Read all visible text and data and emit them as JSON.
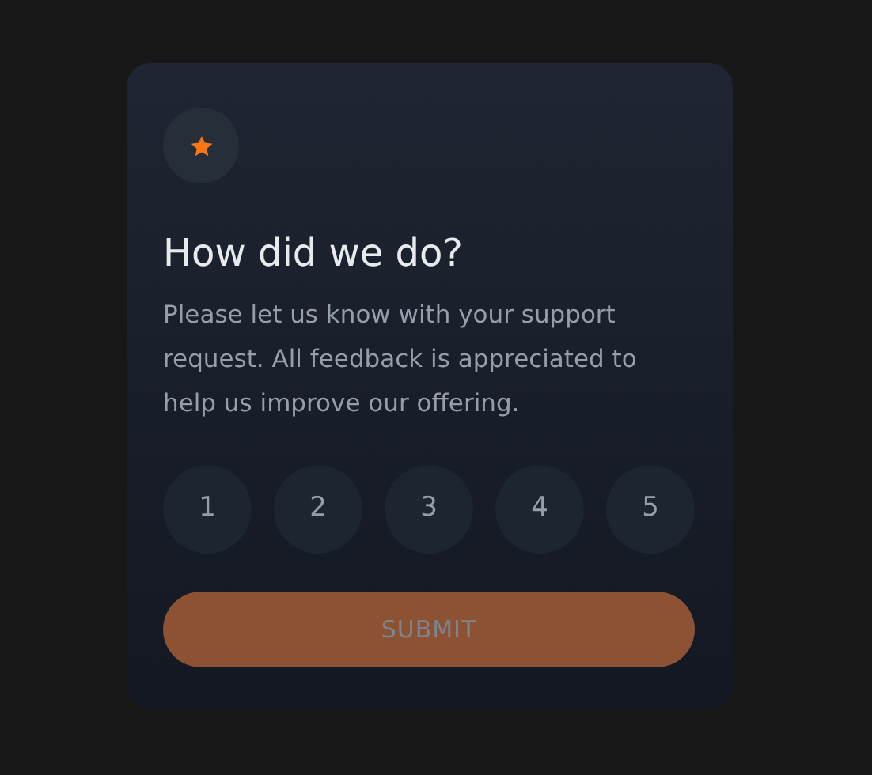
{
  "card": {
    "title": "How did we do?",
    "description": "Please let us know with your support request. All feedback is appreciated to help us improve our offering."
  },
  "ratings": [
    {
      "label": "1",
      "selected": false
    },
    {
      "label": "2",
      "selected": false
    },
    {
      "label": "3",
      "selected": false
    },
    {
      "label": "4",
      "selected": false
    },
    {
      "label": "5",
      "selected": false
    }
  ],
  "submit": {
    "label": "SUBMIT",
    "disabled": true
  }
}
